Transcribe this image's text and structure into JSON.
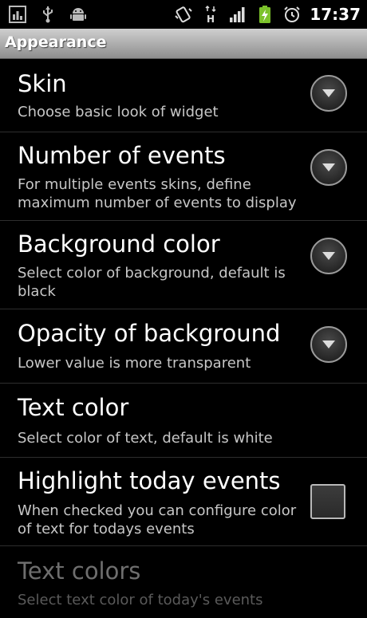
{
  "status_bar": {
    "time": "17:37",
    "icons": [
      "gallery-notification-icon",
      "usb-icon",
      "android-debug-icon",
      "vibrate-icon",
      "hspa-data-icon",
      "signal-icon",
      "battery-charging-icon",
      "alarm-icon"
    ]
  },
  "title_bar": {
    "title": "Appearance"
  },
  "preferences": [
    {
      "label": "Skin",
      "summary": "Choose basic look of widget",
      "control": "dropdown",
      "enabled": true
    },
    {
      "label": "Number of events",
      "summary": "For multiple events skins, define maximum number of events to display",
      "control": "dropdown",
      "enabled": true
    },
    {
      "label": "Background color",
      "summary": "Select color of background, default is black",
      "control": "dropdown",
      "enabled": true
    },
    {
      "label": "Opacity of background",
      "summary": "Lower value is more transparent",
      "control": "dropdown",
      "enabled": true
    },
    {
      "label": "Text color",
      "summary": "Select color of text, default is white",
      "control": "none",
      "enabled": true
    },
    {
      "label": "Highlight today events",
      "summary": "When checked you can configure color of text for todays events",
      "control": "checkbox",
      "checked": false,
      "enabled": true
    },
    {
      "label": "Text colors",
      "summary": "Select text color of today's events",
      "control": "none",
      "enabled": false
    }
  ],
  "colors": {
    "background": "#000000",
    "title_bar_top": "#cfcfcf",
    "title_bar_bottom": "#8e8e8e",
    "battery": "#7cc22b",
    "summary_text": "#c7c7c7",
    "disabled_text": "#6e6e6e"
  }
}
